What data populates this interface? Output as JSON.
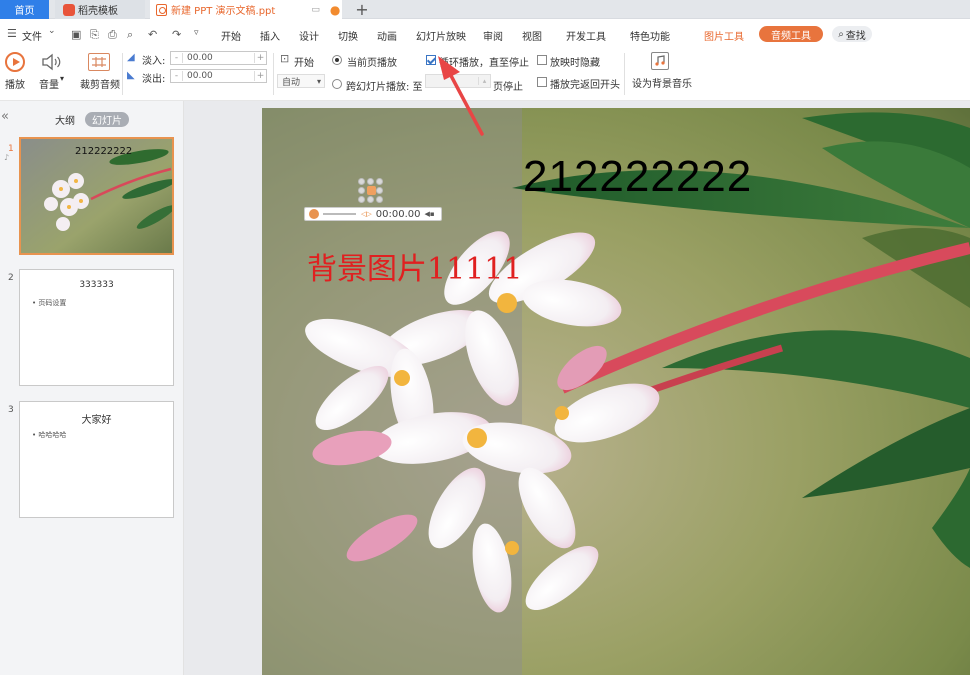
{
  "tabs": {
    "home": "首页",
    "template": "稻壳模板",
    "doc": "新建 PPT 演示文稿.ppt"
  },
  "menu": {
    "file": "文件",
    "items": [
      "开始",
      "插入",
      "设计",
      "切换",
      "动画",
      "幻灯片放映",
      "审阅",
      "视图",
      "开发工具",
      "特色功能"
    ],
    "picture_tools": "图片工具",
    "audio_tools": "音频工具",
    "search": "查找"
  },
  "ribbon": {
    "play": "播放",
    "volume": "音量",
    "trim": "裁剪音频",
    "fade_in_label": "淡入:",
    "fade_out_label": "淡出:",
    "fade_in_value": "00.00",
    "fade_out_value": "00.00",
    "start_label": "开始",
    "start_value": "自动",
    "current_page": "当前页播放",
    "cross_slide": "跨幻灯片播放: 至",
    "page_stop": "页停止",
    "loop": "循环播放，直至停止",
    "hide_during": "放映时隐藏",
    "rewind": "播放完返回开头",
    "set_bg_music": "设为背景音乐",
    "loop_checked": true,
    "current_page_selected": true
  },
  "sidebar": {
    "outline_tab": "大纲",
    "slides_tab": "幻灯片",
    "slides": [
      {
        "num": "1",
        "title": "212222222",
        "bullet": ""
      },
      {
        "num": "2",
        "title": "333333",
        "bullet": "页码设置"
      },
      {
        "num": "3",
        "title": "大家好",
        "bullet": "哈哈哈哈"
      }
    ]
  },
  "slide": {
    "title": "212222222",
    "red_text": "背景图片11111",
    "audio_time": "00:00.00"
  },
  "colors": {
    "accent": "#e8743d",
    "home_tab": "#2f7fe8",
    "red_text": "#e02020",
    "arrow": "#e84545"
  }
}
